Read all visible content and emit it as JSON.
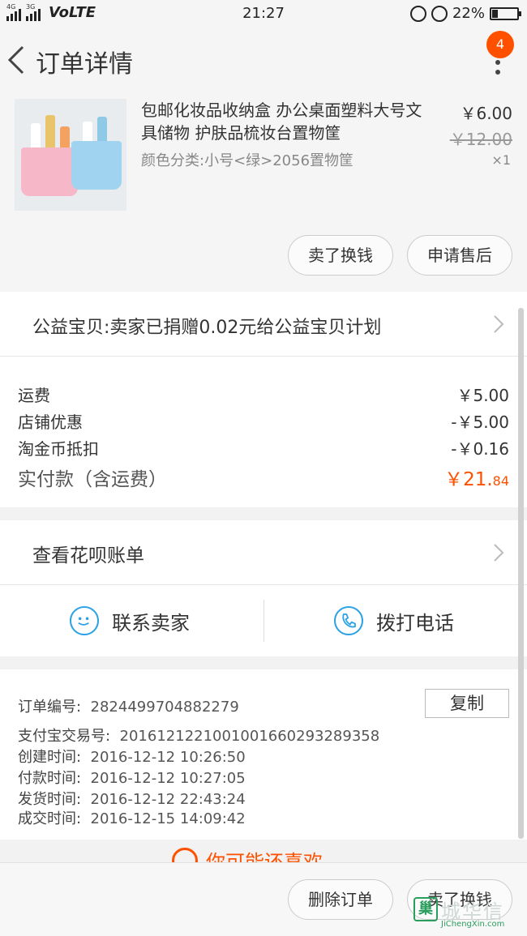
{
  "status_bar": {
    "net1": "4G",
    "net2": "3G",
    "volte": "VoLTE",
    "time": "21:27",
    "battery_pct": "22%",
    "battery_level": 0.22
  },
  "header": {
    "title": "订单详情",
    "badge_count": "4"
  },
  "product": {
    "name": "包邮化妆品收纳盒 办公桌面塑料大号文具储物 护肤品梳妆台置物筐",
    "sku": "颜色分类:小号<绿>2056置物筐",
    "price": "￥6.00",
    "original_price": "￥12.00",
    "quantity": "×1",
    "actions": [
      "卖了换钱",
      "申请售后"
    ]
  },
  "charity": {
    "text": "公益宝贝:卖家已捐赠0.02元给公益宝贝计划"
  },
  "fees": [
    {
      "label": "运费",
      "value": "￥5.00"
    },
    {
      "label": "店铺优惠",
      "value": "-￥5.00"
    },
    {
      "label": "淘金币抵扣",
      "value": "-￥0.16"
    }
  ],
  "total": {
    "label": "实付款（含运费）",
    "integer": "￥21.",
    "decimal": "84"
  },
  "huabei": {
    "text": "查看花呗账单"
  },
  "contact": {
    "seller": "联系卖家",
    "phone": "拨打电话"
  },
  "order_info": {
    "copy_label": "复制",
    "rows": [
      {
        "label": "订单编号:",
        "value": "2824499704882279"
      },
      {
        "label": "支付宝交易号:",
        "value": "2016121221001001660293289358"
      },
      {
        "label": "创建时间:",
        "value": "2016-12-12 10:26:50"
      },
      {
        "label": "付款时间:",
        "value": "2016-12-12 10:27:05"
      },
      {
        "label": "发货时间:",
        "value": "2016-12-12 22:43:24"
      },
      {
        "label": "成交时间:",
        "value": "2016-12-15 14:09:42"
      }
    ]
  },
  "guess": {
    "text": "你可能还喜欢"
  },
  "bottom_bar": {
    "actions": [
      "删除订单",
      "卖了换钱"
    ]
  },
  "watermark": {
    "glyph": "巢",
    "name": "城华信",
    "url": "JiChengXin.com"
  }
}
